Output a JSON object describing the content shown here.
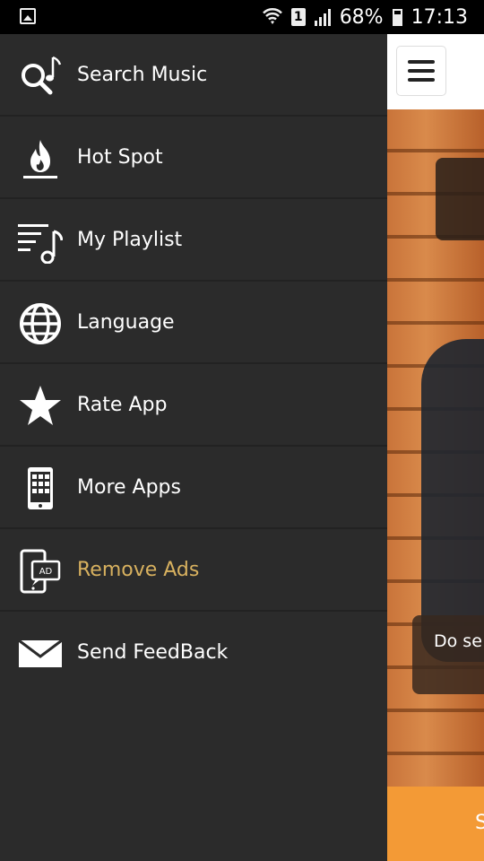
{
  "status_bar": {
    "battery_text": "68%",
    "time": "17:13",
    "sim_label": "1"
  },
  "drawer": {
    "items": [
      {
        "label": "Search Music",
        "icon": "search-music-icon"
      },
      {
        "label": "Hot Spot",
        "icon": "flame-icon"
      },
      {
        "label": "My Playlist",
        "icon": "playlist-icon"
      },
      {
        "label": "Language",
        "icon": "globe-icon"
      },
      {
        "label": "Rate App",
        "icon": "star-icon"
      },
      {
        "label": "More Apps",
        "icon": "phone-apps-icon"
      },
      {
        "label": "Remove Ads",
        "icon": "remove-ads-icon",
        "accent": "#d8b15f"
      },
      {
        "label": "Send FeedBack",
        "icon": "envelope-icon"
      }
    ]
  },
  "content": {
    "card_text": "Do se",
    "bottom_button_text": "S"
  },
  "colors": {
    "drawer_bg": "#2b2b2b",
    "accent": "#d8b15f",
    "orange": "#f39a36"
  }
}
